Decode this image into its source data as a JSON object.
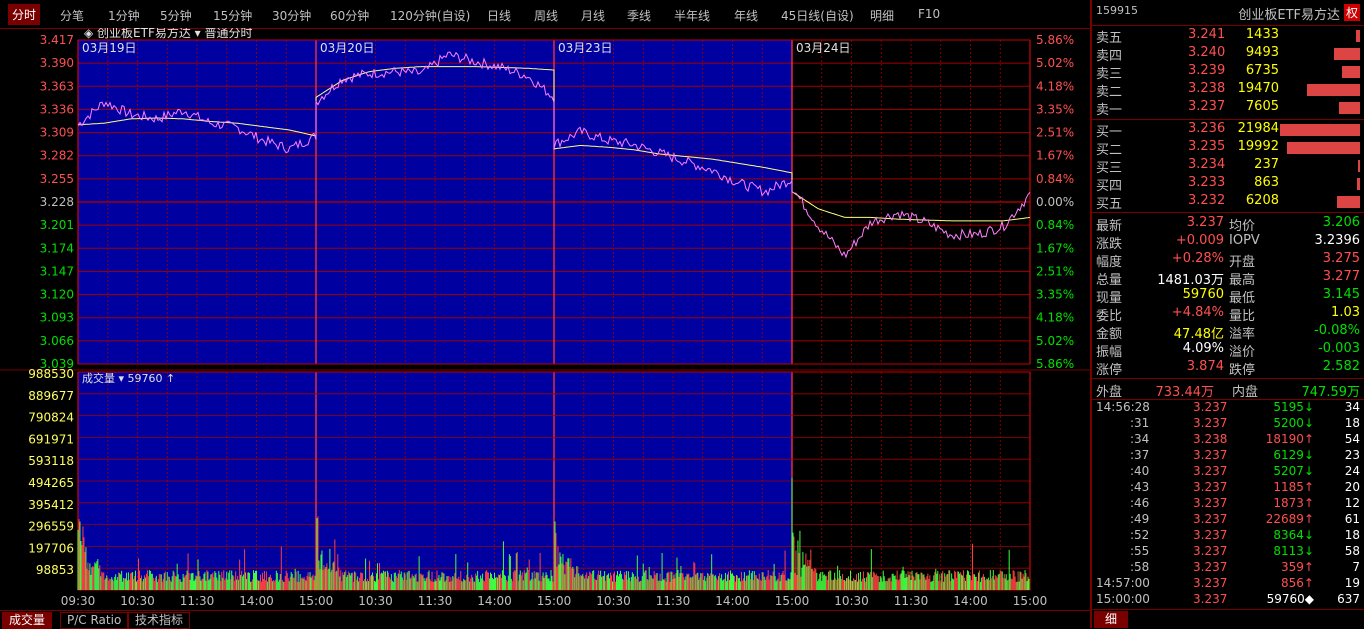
{
  "toolbar": {
    "tabs": [
      "分时",
      "分笔",
      "1分钟",
      "5分钟",
      "15分钟",
      "30分钟",
      "60分钟",
      "120分钟(自设)",
      "日线",
      "周线",
      "月线",
      "季线",
      "半年线",
      "年线",
      "45日线(自设)",
      "明细",
      "F10"
    ]
  },
  "chart": {
    "title": "创业板ETF易方达",
    "mode": "普通分时",
    "dates": [
      "03月19日",
      "03月20日",
      "03月23日",
      "03月24日"
    ],
    "price_ticks": [
      "3.417",
      "3.390",
      "3.363",
      "3.336",
      "3.309",
      "3.282",
      "3.255",
      "3.228",
      "3.201",
      "3.174",
      "3.147",
      "3.120",
      "3.093",
      "3.066",
      "3.039"
    ],
    "pct_ticks": [
      "5.86%",
      "5.02%",
      "4.18%",
      "3.35%",
      "2.51%",
      "1.67%",
      "0.84%",
      "0.00%",
      "0.84%",
      "1.67%",
      "2.51%",
      "3.35%",
      "4.18%",
      "5.02%",
      "5.86%"
    ],
    "volume_label": "成交量",
    "volume_value": "59760",
    "volume_ticks": [
      "988530",
      "889677",
      "790824",
      "691971",
      "593118",
      "494265",
      "395412",
      "296559",
      "197706",
      "98853"
    ],
    "time_ticks": [
      "09:30",
      "10:30",
      "11:30",
      "14:00",
      "15:00",
      "10:30",
      "11:30",
      "14:00",
      "15:00",
      "10:30",
      "11:30",
      "14:00",
      "15:00",
      "10:30",
      "11:30",
      "14:00",
      "15:00"
    ],
    "colors": {
      "past_bg": "#0000a0",
      "grid": "#a00000",
      "price_line": "#ff80ff",
      "avg_line": "#ffff80",
      "up": "#ff4040",
      "down": "#40ff40"
    }
  },
  "bottom_tabs": [
    "成交量",
    "P/C Ratio",
    "技术指标"
  ],
  "panel": {
    "code": "159915",
    "name": "创业板ETF易方达",
    "badge": "权",
    "asks": [
      {
        "label": "卖五",
        "price": "3.241",
        "vol": "1433"
      },
      {
        "label": "卖四",
        "price": "3.240",
        "vol": "9493"
      },
      {
        "label": "卖三",
        "price": "3.239",
        "vol": "6735"
      },
      {
        "label": "卖二",
        "price": "3.238",
        "vol": "19470"
      },
      {
        "label": "卖一",
        "price": "3.237",
        "vol": "7605"
      }
    ],
    "bids": [
      {
        "label": "买一",
        "price": "3.236",
        "vol": "21984"
      },
      {
        "label": "买二",
        "price": "3.235",
        "vol": "19992"
      },
      {
        "label": "买三",
        "price": "3.234",
        "vol": "237"
      },
      {
        "label": "买四",
        "price": "3.233",
        "vol": "863"
      },
      {
        "label": "买五",
        "price": "3.232",
        "vol": "6208"
      }
    ],
    "stats": [
      {
        "l1": "最新",
        "v1": "3.237",
        "c1": "red",
        "l2": "均价",
        "v2": "3.206",
        "c2": "green"
      },
      {
        "l1": "涨跌",
        "v1": "+0.009",
        "c1": "red",
        "l2": "IOPV",
        "v2": "3.2396",
        "c2": "white"
      },
      {
        "l1": "幅度",
        "v1": "+0.28%",
        "c1": "red",
        "l2": "开盘",
        "v2": "3.275",
        "c2": "red"
      },
      {
        "l1": "总量",
        "v1": "1481.03万",
        "c1": "white",
        "l2": "最高",
        "v2": "3.277",
        "c2": "red"
      },
      {
        "l1": "现量",
        "v1": "59760",
        "c1": "yellow",
        "l2": "最低",
        "v2": "3.145",
        "c2": "green"
      },
      {
        "l1": "委比",
        "v1": "+4.84%",
        "c1": "red",
        "l2": "量比",
        "v2": "1.03",
        "c2": "yellow"
      },
      {
        "l1": "金额",
        "v1": "47.48亿",
        "c1": "yellow",
        "l2": "溢率",
        "v2": "-0.08%",
        "c2": "green"
      },
      {
        "l1": "振幅",
        "v1": "4.09%",
        "c1": "white",
        "l2": "溢价",
        "v2": "-0.003",
        "c2": "green"
      },
      {
        "l1": "涨停",
        "v1": "3.874",
        "c1": "red",
        "l2": "跌停",
        "v2": "2.582",
        "c2": "green"
      }
    ],
    "outer_label": "外盘",
    "outer_value": "733.44万",
    "inner_label": "内盘",
    "inner_value": "747.59万",
    "trades": [
      {
        "t": "14:56:28",
        "p": "3.237",
        "v": "5195",
        "d": "down",
        "n": "34"
      },
      {
        "t": ":31",
        "p": "3.237",
        "v": "5200",
        "d": "down",
        "n": "18"
      },
      {
        "t": ":34",
        "p": "3.238",
        "v": "18190",
        "d": "up",
        "n": "54"
      },
      {
        "t": ":37",
        "p": "3.237",
        "v": "6129",
        "d": "down",
        "n": "23"
      },
      {
        "t": ":40",
        "p": "3.237",
        "v": "5207",
        "d": "down",
        "n": "24"
      },
      {
        "t": ":43",
        "p": "3.237",
        "v": "1185",
        "d": "up",
        "n": "20"
      },
      {
        "t": ":46",
        "p": "3.237",
        "v": "1873",
        "d": "up",
        "n": "12"
      },
      {
        "t": ":49",
        "p": "3.237",
        "v": "22689",
        "d": "up",
        "n": "61"
      },
      {
        "t": ":52",
        "p": "3.237",
        "v": "8364",
        "d": "down",
        "n": "18"
      },
      {
        "t": ":55",
        "p": "3.237",
        "v": "8113",
        "d": "down",
        "n": "58"
      },
      {
        "t": ":58",
        "p": "3.237",
        "v": "359",
        "d": "up",
        "n": "7"
      },
      {
        "t": "14:57:00",
        "p": "3.237",
        "v": "856",
        "d": "up",
        "n": "19"
      },
      {
        "t": "15:00:00",
        "p": "3.237",
        "v": "59760",
        "d": "dot",
        "n": "637"
      }
    ],
    "bottom_tab": "细"
  }
}
